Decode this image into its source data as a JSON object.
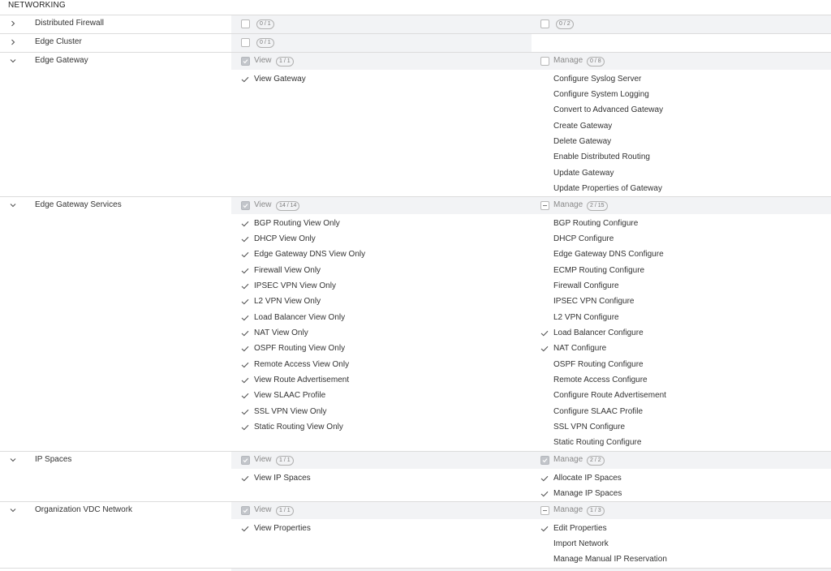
{
  "section_title": "NETWORKING",
  "rows": {
    "distributed_firewall": {
      "name": "Distributed Firewall",
      "col1_badge": "0 / 1",
      "col2_badge": "0 / 2"
    },
    "edge_cluster": {
      "name": "Edge Cluster",
      "col1_badge": "0 / 1"
    },
    "edge_gateway": {
      "name": "Edge Gateway",
      "view_label": "View",
      "view_badge": "1 / 1",
      "manage_label": "Manage",
      "manage_badge": "0 / 8",
      "view_items": [
        "View Gateway"
      ],
      "manage_items": [
        "Configure Syslog Server",
        "Configure System Logging",
        "Convert to Advanced Gateway",
        "Create Gateway",
        "Delete Gateway",
        "Enable Distributed Routing",
        "Update Gateway",
        "Update Properties of Gateway"
      ]
    },
    "edge_gateway_services": {
      "name": "Edge Gateway Services",
      "view_label": "View",
      "view_badge": "14 / 14",
      "manage_label": "Manage",
      "manage_badge": "2 / 15",
      "view_items": [
        "BGP Routing View Only",
        "DHCP View Only",
        "Edge Gateway DNS View Only",
        "Firewall View Only",
        "IPSEC VPN View Only",
        "L2 VPN View Only",
        "Load Balancer View Only",
        "NAT View Only",
        "OSPF Routing View Only",
        "Remote Access View Only",
        "View Route Advertisement",
        "View SLAAC Profile",
        "SSL VPN View Only",
        "Static Routing View Only"
      ],
      "manage_items": [
        "BGP Routing Configure",
        "DHCP Configure",
        "Edge Gateway DNS Configure",
        "ECMP Routing Configure",
        "Firewall Configure",
        "IPSEC VPN Configure",
        "L2 VPN Configure",
        "Load Balancer Configure",
        "NAT Configure",
        "OSPF Routing Configure",
        "Remote Access Configure",
        "Configure Route Advertisement",
        "Configure SLAAC Profile",
        "SSL VPN Configure",
        "Static Routing Configure"
      ]
    },
    "ip_spaces": {
      "name": "IP Spaces",
      "view_label": "View",
      "view_badge": "1 / 1",
      "manage_label": "Manage",
      "manage_badge": "2 / 2",
      "view_items": [
        "View IP Spaces"
      ],
      "manage_items": [
        "Allocate IP Spaces",
        "Manage IP Spaces"
      ]
    },
    "org_vdc_network": {
      "name": "Organization VDC Network",
      "view_label": "View",
      "view_badge": "1 / 1",
      "manage_label": "Manage",
      "manage_badge": "1 / 3",
      "view_items": [
        "View Properties"
      ],
      "manage_items": [
        "Edit Properties",
        "Import Network",
        "Manage Manual IP Reservation"
      ]
    }
  },
  "icons": {
    "collapsed": "chevron-right-icon",
    "expanded": "chevron-down-icon",
    "check": "check-icon"
  },
  "colors": {
    "header_bg": "#f2f3f5",
    "divider": "#dcdcdc",
    "text": "#333333",
    "muted": "#8a8a8a"
  }
}
